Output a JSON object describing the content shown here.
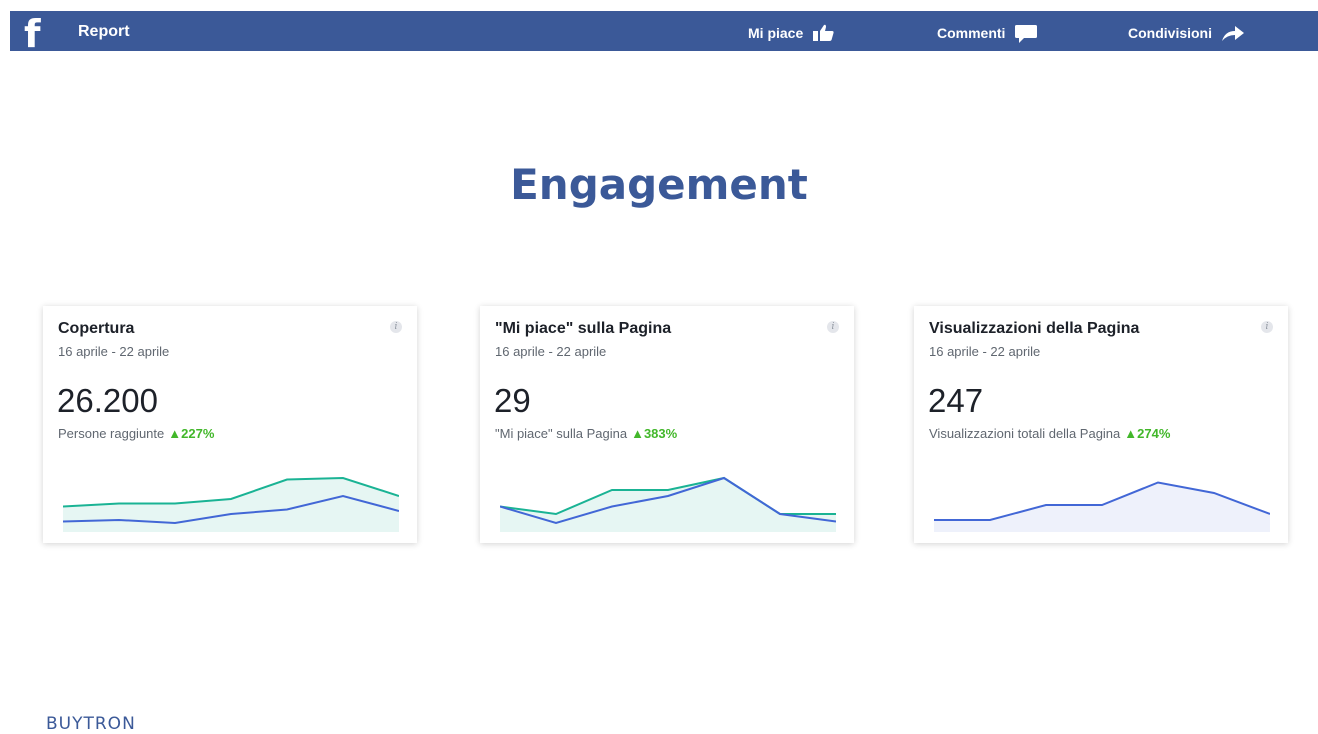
{
  "header": {
    "logo": "f",
    "report_label": "Report",
    "nav": {
      "likes_label": "Mi piace",
      "comments_label": "Commenti",
      "shares_label": "Condivisioni"
    }
  },
  "page_title": "Engagement",
  "cards": [
    {
      "title": "Copertura",
      "date_range": "16 aprile - 22 aprile",
      "value": "26.200",
      "sub_label": "Persone raggiunte",
      "delta": "227%",
      "series_primary": [
        1.5,
        2.0,
        1.0,
        4.0,
        5.5,
        10.0,
        5.0
      ],
      "series_secondary": [
        6.5,
        7.5,
        7.5,
        9.0,
        15.5,
        16.0,
        10.0
      ]
    },
    {
      "title": "\"Mi piace\" sulla Pagina",
      "date_range": "16 aprile - 22 aprile",
      "value": "29",
      "sub_label": "\"Mi piace\" sulla Pagina",
      "delta": "383%",
      "series_primary": [
        6.5,
        1.0,
        6.5,
        10.0,
        16.0,
        4.0,
        1.5
      ],
      "series_secondary": [
        6.5,
        4.0,
        12.0,
        12.0,
        16.0,
        4.0,
        4.0
      ]
    },
    {
      "title": "Visualizzazioni della Pagina",
      "date_range": "16 aprile - 22 aprile",
      "value": "247",
      "sub_label": "Visualizzazioni totali della Pagina",
      "delta": "274%",
      "series_primary": [
        2.0,
        2.0,
        7.0,
        7.0,
        14.5,
        11.0,
        4.0
      ]
    }
  ],
  "colors": {
    "brand": "#3b5998",
    "primary_line": "#4267d6",
    "secondary_line": "#1ab394",
    "delta": "#42b72a"
  },
  "footer": {
    "logo_text": "BUYTRON"
  }
}
